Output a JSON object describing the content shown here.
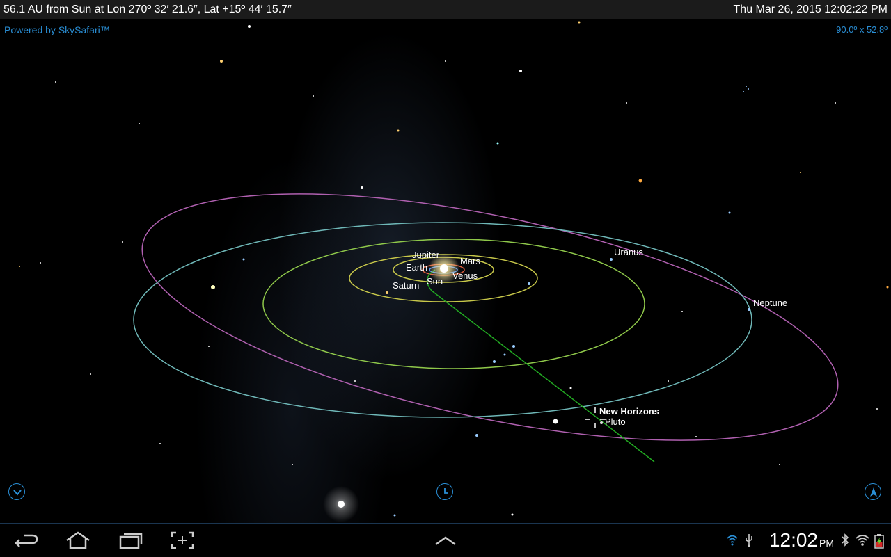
{
  "topbar": {
    "location": "56.1 AU from Sun at Lon 270º 32′ 21.6″, Lat +15º 44′ 15.7″",
    "datetime": "Thu Mar 26, 2015  12:02:22 PM"
  },
  "sky": {
    "powered_by": "Powered by SkySafari™",
    "field_of_view": "90.0º x 52.8º",
    "labels": {
      "jupiter": "Jupiter",
      "mars": "Mars",
      "earth": "Earth",
      "venus": "Venus",
      "sun": "Sun",
      "saturn": "Saturn",
      "uranus": "Uranus",
      "neptune": "Neptune",
      "new_horizons": "New Horizons",
      "pluto": "Pluto"
    },
    "colors": {
      "accent": "#2a8fd6",
      "orbit_inner": "#c8c84a",
      "orbit_saturn": "#8fc84a",
      "orbit_uranus_neptune": "#6fb8b8",
      "orbit_pluto": "#b060b0",
      "trajectory": "#22aa22"
    }
  },
  "hud": {
    "left_button_icon": "chevron-down-icon",
    "center_button_icon": "clock-icon",
    "right_button_icon": "compass-arrow-icon"
  },
  "navbar": {
    "back_icon": "back-icon",
    "home_icon": "home-icon",
    "recents_icon": "recent-apps-icon",
    "screenshot_icon": "screenshot-icon",
    "up_icon": "chevron-up-icon",
    "clock_time": "12:02",
    "clock_ampm": "PM"
  }
}
